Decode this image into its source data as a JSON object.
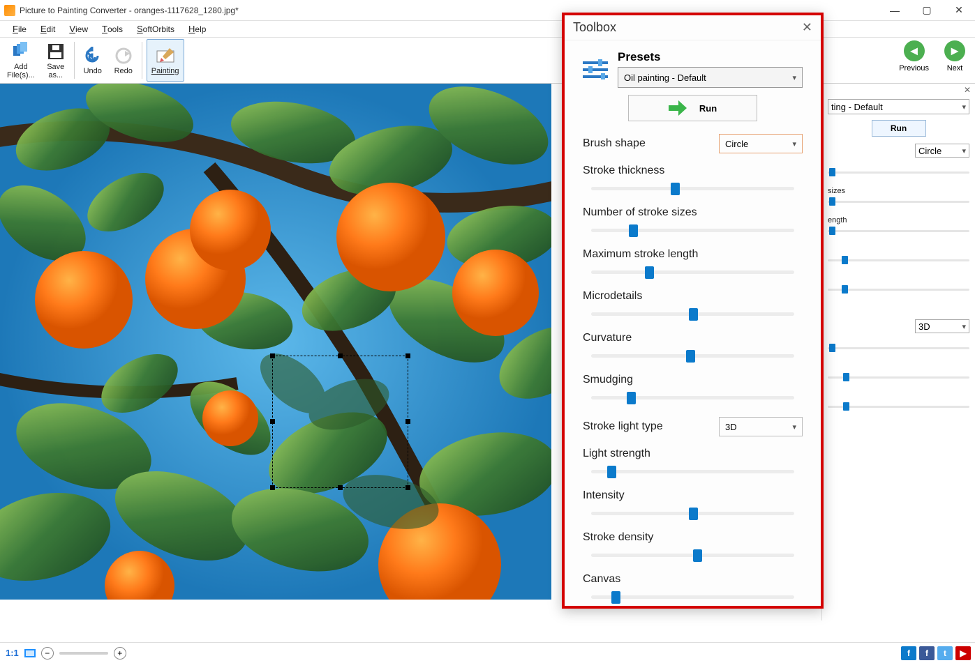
{
  "title": "Picture to Painting Converter - oranges-1117628_1280.jpg*",
  "menu": {
    "file": "File",
    "edit": "Edit",
    "view": "View",
    "tools": "Tools",
    "softorbits": "SoftOrbits",
    "help": "Help"
  },
  "ribbon": {
    "add_files": "Add\nFile(s)...",
    "save_as": "Save\nas...",
    "undo": "Undo",
    "redo": "Redo",
    "painting": "Painting",
    "previous": "Previous",
    "next": "Next"
  },
  "toolbox": {
    "title": "Toolbox",
    "presets_label": "Presets",
    "preset_value": "Oil painting - Default",
    "run": "Run",
    "brush_shape_label": "Brush shape",
    "brush_shape_value": "Circle",
    "stroke_light_type_label": "Stroke light type",
    "stroke_light_type_value": "3D",
    "params": [
      {
        "label": "Stroke thickness",
        "pos": 42
      },
      {
        "label": "Number of stroke sizes",
        "pos": 23
      },
      {
        "label": "Maximum stroke length",
        "pos": 30
      },
      {
        "label": "Microdetails",
        "pos": 50
      },
      {
        "label": "Curvature",
        "pos": 49
      },
      {
        "label": "Smudging",
        "pos": 22
      }
    ],
    "params2": [
      {
        "label": "Light strength",
        "pos": 13
      },
      {
        "label": "Intensity",
        "pos": 50
      },
      {
        "label": "Stroke density",
        "pos": 52
      },
      {
        "label": "Canvas",
        "pos": 15
      }
    ]
  },
  "sidepanel": {
    "preset_suffix": "ting - Default",
    "run": "Run",
    "brush_value": "Circle",
    "rows": [
      "sizes",
      "ength"
    ],
    "light_value": "3D"
  },
  "status": {
    "onetoone": "1:1"
  }
}
